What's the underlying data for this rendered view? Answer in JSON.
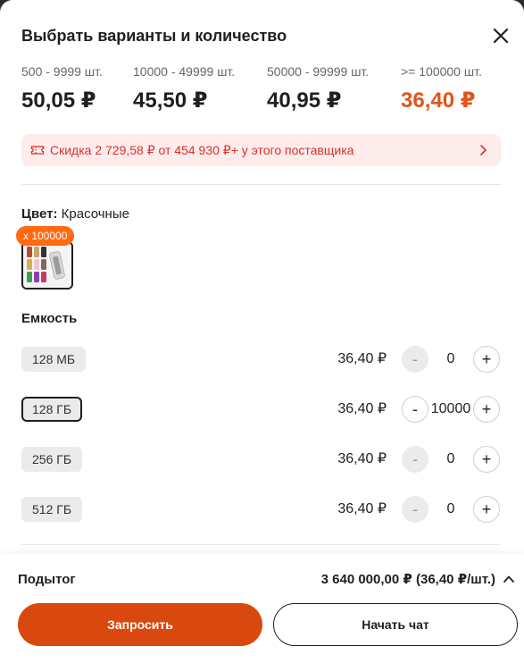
{
  "header": {
    "title": "Выбрать варианты и количество"
  },
  "tiers": [
    {
      "range": "500 - 9999 шт.",
      "price": "50,05 ₽"
    },
    {
      "range": "10000 - 49999 шт.",
      "price": "45,50 ₽"
    },
    {
      "range": "50000 - 99999 шт.",
      "price": "40,95 ₽"
    },
    {
      "range": ">= 100000 шт.",
      "price": "36,40 ₽",
      "highlight": true
    }
  ],
  "discount": {
    "text": "Скидка 2 729,58 ₽ от 454 930 ₽+ у этого поставщика"
  },
  "color": {
    "label": "Цвет:",
    "value": "Красочные",
    "badge": "x 100000"
  },
  "capacity": {
    "title": "Емкость",
    "variants": [
      {
        "name": "128 МБ",
        "price": "36,40 ₽",
        "qty": "0",
        "selected": false
      },
      {
        "name": "128 ГБ",
        "price": "36,40 ₽",
        "qty": "10000",
        "selected": true
      },
      {
        "name": "256 ГБ",
        "price": "36,40 ₽",
        "qty": "0",
        "selected": false
      },
      {
        "name": "512 ГБ",
        "price": "36,40 ₽",
        "qty": "0",
        "selected": false
      }
    ],
    "minus": "-",
    "plus": "+"
  },
  "footer": {
    "subtotal_label": "Подытог",
    "subtotal_value": "3 640 000,00 ₽ (36,40 ₽/шт.)",
    "request_label": "Запросить",
    "chat_label": "Начать чат"
  },
  "colors": {
    "accent": "#e0541b",
    "primary_button": "#d9480f",
    "badge": "#ff6a13",
    "discount_text": "#d9302b"
  }
}
